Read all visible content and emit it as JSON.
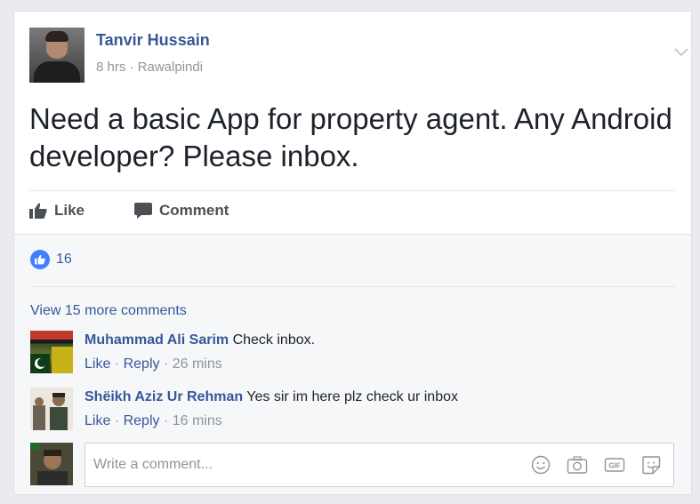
{
  "post": {
    "author": "Tanvir Hussain",
    "meta": "8 hrs · Rawalpindi",
    "text": "Need a basic App for property agent. Any Android developer? Please inbox.",
    "chevron_icon": "chevron-down-icon"
  },
  "actions": {
    "like_label": "Like",
    "comment_label": "Comment",
    "like_icon": "thumbs-up-icon",
    "comment_icon": "speech-bubble-icon"
  },
  "reactions": {
    "count": "16",
    "icon": "thumbs-up-icon",
    "accent_color": "#4080ff"
  },
  "comments": {
    "view_more_label": "View 15 more comments",
    "items": [
      {
        "name": "Muhammad Ali Sarim",
        "text": "Check inbox.",
        "like_label": "Like",
        "separator": "·",
        "reply_label": "Reply",
        "time": "26 mins"
      },
      {
        "name": "Shëikh Aziz Ur Rehman",
        "text": "Yes sir im here plz check ur inbox",
        "like_label": "Like",
        "separator": "·",
        "reply_label": "Reply",
        "time": "16 mins"
      }
    ]
  },
  "composer": {
    "placeholder": "Write a comment...",
    "icons": [
      "emoji-icon",
      "camera-icon",
      "gif-icon",
      "sticker-icon"
    ]
  },
  "colors": {
    "link": "#365899",
    "text": "#1d2129",
    "muted": "#90949c",
    "background": "#e9ebee"
  }
}
